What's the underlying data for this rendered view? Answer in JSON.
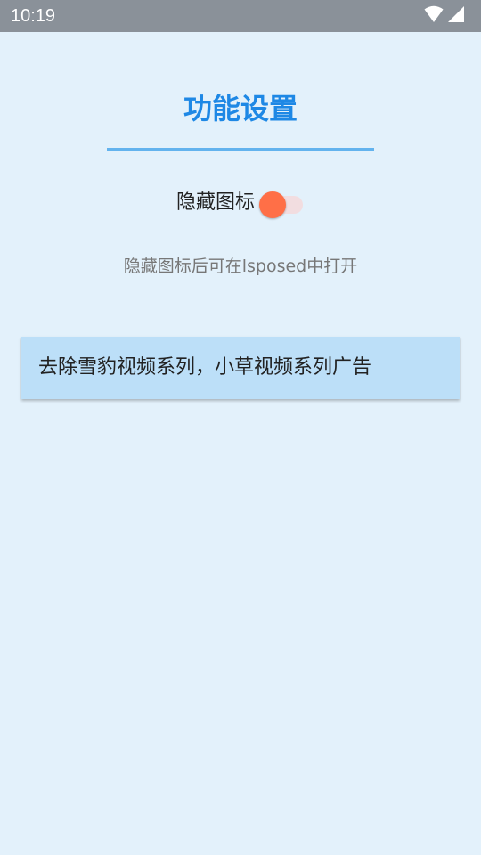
{
  "status_bar": {
    "time": "10:19",
    "icons": [
      "wifi-icon",
      "cellular-signal-icon"
    ],
    "background": "#8a9199"
  },
  "page": {
    "title": "功能设置",
    "title_color": "#1e88e5",
    "background": "#e3f1fb"
  },
  "hide_icon": {
    "label": "隐藏图标",
    "checked": true,
    "thumb_color": "#ff6f47",
    "track_color": "#f2dde0"
  },
  "hint": "隐藏图标后可在lsposed中打开",
  "features": [
    {
      "label": "去除雪豹视频系列，小草视频系列广告"
    }
  ]
}
